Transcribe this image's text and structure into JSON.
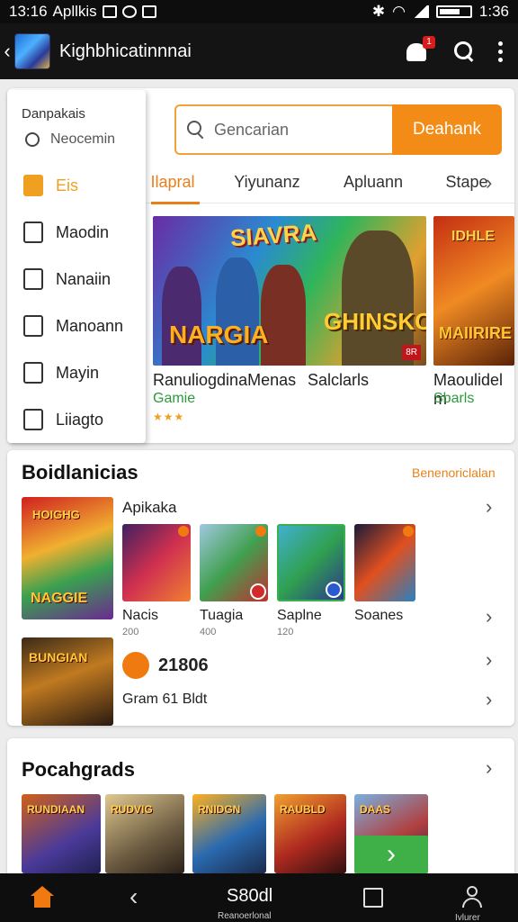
{
  "status_bar": {
    "time_left": "13:16",
    "app_label": "Apllkis",
    "time_right": "1:36"
  },
  "app_bar": {
    "title": "Kighbhicatinnnai",
    "notification_count": "1"
  },
  "search": {
    "placeholder": "Gencarian",
    "button": "Deahank"
  },
  "tabs": [
    "Ilapral",
    "Yiyunanz",
    "Apluann",
    "Stape"
  ],
  "drawer": {
    "header": "Danpakais",
    "radio_label": "Neocemin",
    "items": [
      {
        "label": "Eis",
        "icon": "grid-icon",
        "active": true
      },
      {
        "label": "Maodin",
        "icon": "tablet-icon"
      },
      {
        "label": "Nanaiin",
        "icon": "square-icon"
      },
      {
        "label": "Manoann",
        "icon": "camera-icon"
      },
      {
        "label": "Mayin",
        "icon": "bookmark-icon"
      },
      {
        "label": "Liiagto",
        "icon": "tv-icon"
      }
    ]
  },
  "featured": [
    {
      "name": "RanuliogdinaMenas",
      "category": "Gamie",
      "stars": "★★★",
      "banner_title": "SIAVRA",
      "banner_sub": "NARGIA",
      "banner_sub2": "GHINSKON",
      "tag": "8R"
    },
    {
      "name": "Salclarls"
    },
    {
      "name": "Maoulidel m",
      "category": "Sbarls",
      "banner_title": "IDHLE",
      "banner_sub": "MAIIRIRE"
    }
  ],
  "recommended": {
    "title": "Boidlanicias",
    "link": "Benenoriclalan",
    "sub_label": "Apikaka",
    "big_thumb": {
      "title": "HOIGHG",
      "sub": "NAGGIE"
    },
    "games": [
      {
        "name": "Nacis",
        "meta": "200"
      },
      {
        "name": "Tuagia",
        "meta": "400"
      },
      {
        "name": "Saplne",
        "meta": "120"
      },
      {
        "name": "Soanes"
      }
    ],
    "extra": {
      "thumb_title": "BUNGIAN",
      "score": "21806",
      "label": "Gram 61 Bldt"
    }
  },
  "popular": {
    "title": "Pocahgrads",
    "thumbs": [
      "RUNDIAAN",
      "RUDVIG",
      "RNIDGN",
      "RAUBLD",
      "DAAS"
    ]
  },
  "bottom_nav": {
    "center_label": "S80dl",
    "center_sub": "Reanoerlonal",
    "user_sub": "Ivlurer"
  },
  "colors": {
    "accent": "#f28c17",
    "green": "#2b9a3b",
    "appbar": "#141414"
  }
}
